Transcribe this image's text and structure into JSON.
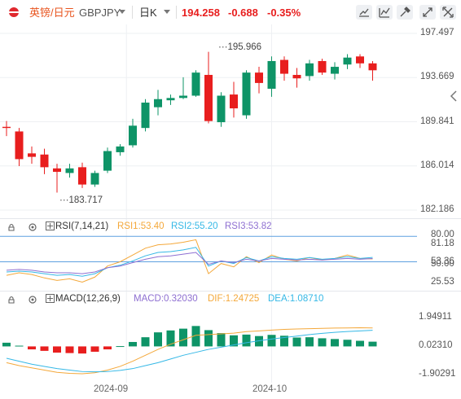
{
  "header": {
    "instrument_name": "英镑/日元",
    "symbol": "GBPJPY",
    "timeframe": "日K",
    "price": "194.258",
    "change": "-0.688",
    "change_pct": "-0.35%"
  },
  "colors": {
    "up": "#0e9467",
    "down": "#e81e1e",
    "rsi1": "#f4a83a",
    "rsi2": "#35b8e6",
    "rsi3": "#8e6fd1",
    "macd": "#f4a83a",
    "dif": "#f4a83a",
    "dea": "#35b8e6",
    "axis_text": "#555555",
    "accent": "#2b7fd1"
  },
  "icons": [
    "flag-icon",
    "dropdown-icon",
    "dropdown-icon",
    "draw-icon",
    "indicator-icon",
    "tools-icon",
    "compare-icon",
    "fullscreen-icon",
    "lock-icon",
    "settings-icon",
    "collapse-icon"
  ],
  "price_axis": {
    "labels": [
      "197.497",
      "193.669",
      "189.841",
      "186.014",
      "182.186"
    ]
  },
  "annotations": {
    "high": "195.966",
    "low": "183.717"
  },
  "rsi": {
    "title": "RSI(7,14,21)",
    "rsi1": "RSI1:53.40",
    "rsi2": "RSI2:55.20",
    "rsi3": "RSI3:53.82",
    "axis": [
      "80.00",
      "81.18",
      "53.36",
      "50.00",
      "25.53"
    ]
  },
  "macd": {
    "title": "MACD(12,26,9)",
    "macd": "MACD:0.32030",
    "dif": "DIF:1.24725",
    "dea": "DEA:1.08710",
    "axis": [
      "1.94911",
      "0.02310",
      "-1.90291"
    ]
  },
  "dates": [
    "2024-09",
    "2024-10"
  ],
  "chart_data": [
    {
      "type": "candlestick",
      "title": "GBPJPY",
      "ylim": [
        182.186,
        197.497
      ],
      "candles": [
        {
          "o": 189.4,
          "h": 189.9,
          "l": 188.6,
          "c": 189.3
        },
        {
          "o": 189.0,
          "h": 189.3,
          "l": 186.0,
          "c": 186.6
        },
        {
          "o": 187.1,
          "h": 187.7,
          "l": 186.2,
          "c": 186.8
        },
        {
          "o": 187.0,
          "h": 187.5,
          "l": 185.3,
          "c": 185.9
        },
        {
          "o": 185.8,
          "h": 186.2,
          "l": 183.7,
          "c": 185.5
        },
        {
          "o": 185.4,
          "h": 186.2,
          "l": 185.0,
          "c": 185.8
        },
        {
          "o": 185.9,
          "h": 186.3,
          "l": 184.1,
          "c": 184.4
        },
        {
          "o": 184.4,
          "h": 185.6,
          "l": 184.2,
          "c": 185.4
        },
        {
          "o": 185.6,
          "h": 187.6,
          "l": 185.4,
          "c": 187.3
        },
        {
          "o": 187.2,
          "h": 187.9,
          "l": 186.9,
          "c": 187.7
        },
        {
          "o": 187.8,
          "h": 190.1,
          "l": 187.6,
          "c": 189.5
        },
        {
          "o": 189.3,
          "h": 191.8,
          "l": 189.0,
          "c": 191.5
        },
        {
          "o": 191.1,
          "h": 192.6,
          "l": 190.4,
          "c": 191.8
        },
        {
          "o": 191.7,
          "h": 192.2,
          "l": 191.3,
          "c": 191.9
        },
        {
          "o": 191.9,
          "h": 193.7,
          "l": 191.8,
          "c": 192.1
        },
        {
          "o": 192.1,
          "h": 194.3,
          "l": 192.0,
          "c": 194.1
        },
        {
          "o": 193.9,
          "h": 195.9,
          "l": 189.7,
          "c": 189.9
        },
        {
          "o": 189.8,
          "h": 192.4,
          "l": 189.4,
          "c": 192.1
        },
        {
          "o": 192.2,
          "h": 193.3,
          "l": 190.2,
          "c": 191.0
        },
        {
          "o": 190.4,
          "h": 194.3,
          "l": 190.1,
          "c": 194.1
        },
        {
          "o": 194.1,
          "h": 194.6,
          "l": 192.3,
          "c": 193.2
        },
        {
          "o": 192.7,
          "h": 195.5,
          "l": 192.0,
          "c": 195.1
        },
        {
          "o": 195.2,
          "h": 195.5,
          "l": 193.4,
          "c": 194.0
        },
        {
          "o": 193.9,
          "h": 194.5,
          "l": 192.8,
          "c": 193.6
        },
        {
          "o": 193.8,
          "h": 195.2,
          "l": 193.4,
          "c": 194.9
        },
        {
          "o": 195.1,
          "h": 195.3,
          "l": 193.9,
          "c": 194.1
        },
        {
          "o": 194.0,
          "h": 195.0,
          "l": 193.5,
          "c": 194.6
        },
        {
          "o": 194.8,
          "h": 195.7,
          "l": 194.4,
          "c": 195.4
        },
        {
          "o": 195.5,
          "h": 195.7,
          "l": 194.5,
          "c": 194.9
        },
        {
          "o": 194.9,
          "h": 195.1,
          "l": 193.4,
          "c": 194.3
        }
      ]
    },
    {
      "type": "line",
      "title": "RSI(7,14,21)",
      "ylim": [
        25.53,
        81.18
      ],
      "series": [
        {
          "name": "RSI1",
          "values": [
            34,
            37,
            35,
            31,
            28,
            30,
            26,
            32,
            45,
            50,
            58,
            66,
            70,
            71,
            73,
            76,
            36,
            48,
            44,
            56,
            49,
            58,
            53,
            51,
            55,
            52,
            54,
            58,
            54,
            53.4
          ]
        },
        {
          "name": "RSI2",
          "values": [
            38,
            39,
            38,
            36,
            34,
            35,
            33,
            36,
            43,
            46,
            51,
            57,
            61,
            62,
            64,
            67,
            45,
            51,
            48,
            55,
            51,
            56,
            54,
            53,
            55,
            53,
            54,
            56,
            54,
            55.2
          ]
        },
        {
          "name": "RSI3",
          "values": [
            40,
            41,
            40,
            38,
            37,
            37,
            36,
            38,
            43,
            45,
            49,
            53,
            56,
            57,
            59,
            61,
            47,
            51,
            49,
            53,
            51,
            54,
            53,
            52,
            53,
            52,
            53,
            54,
            53,
            53.82
          ]
        }
      ]
    },
    {
      "type": "bar",
      "title": "MACD(12,26,9)",
      "ylim": [
        -1.90291,
        1.94911
      ],
      "series": [
        {
          "name": "MACD",
          "values": [
            0.25,
            0.05,
            -0.2,
            -0.3,
            -0.42,
            -0.45,
            -0.48,
            -0.36,
            -0.2,
            0.02,
            0.3,
            0.62,
            0.95,
            1.08,
            1.2,
            1.38,
            1.1,
            0.9,
            0.75,
            0.8,
            0.7,
            0.78,
            0.72,
            0.6,
            0.62,
            0.55,
            0.5,
            0.45,
            0.38,
            0.32
          ]
        },
        {
          "name": "DIF",
          "values": [
            -1.1,
            -1.3,
            -1.45,
            -1.6,
            -1.75,
            -1.82,
            -1.85,
            -1.78,
            -1.6,
            -1.35,
            -1.0,
            -0.6,
            -0.2,
            0.15,
            0.45,
            0.75,
            0.8,
            0.85,
            0.9,
            1.0,
            1.05,
            1.1,
            1.15,
            1.18,
            1.2,
            1.22,
            1.24,
            1.25,
            1.26,
            1.25
          ]
        },
        {
          "name": "DEA",
          "values": [
            -0.8,
            -1.0,
            -1.2,
            -1.35,
            -1.5,
            -1.6,
            -1.7,
            -1.72,
            -1.7,
            -1.62,
            -1.5,
            -1.3,
            -1.1,
            -0.85,
            -0.6,
            -0.4,
            -0.2,
            -0.05,
            0.1,
            0.25,
            0.38,
            0.5,
            0.6,
            0.7,
            0.8,
            0.88,
            0.95,
            1.01,
            1.05,
            1.09
          ]
        }
      ]
    }
  ]
}
